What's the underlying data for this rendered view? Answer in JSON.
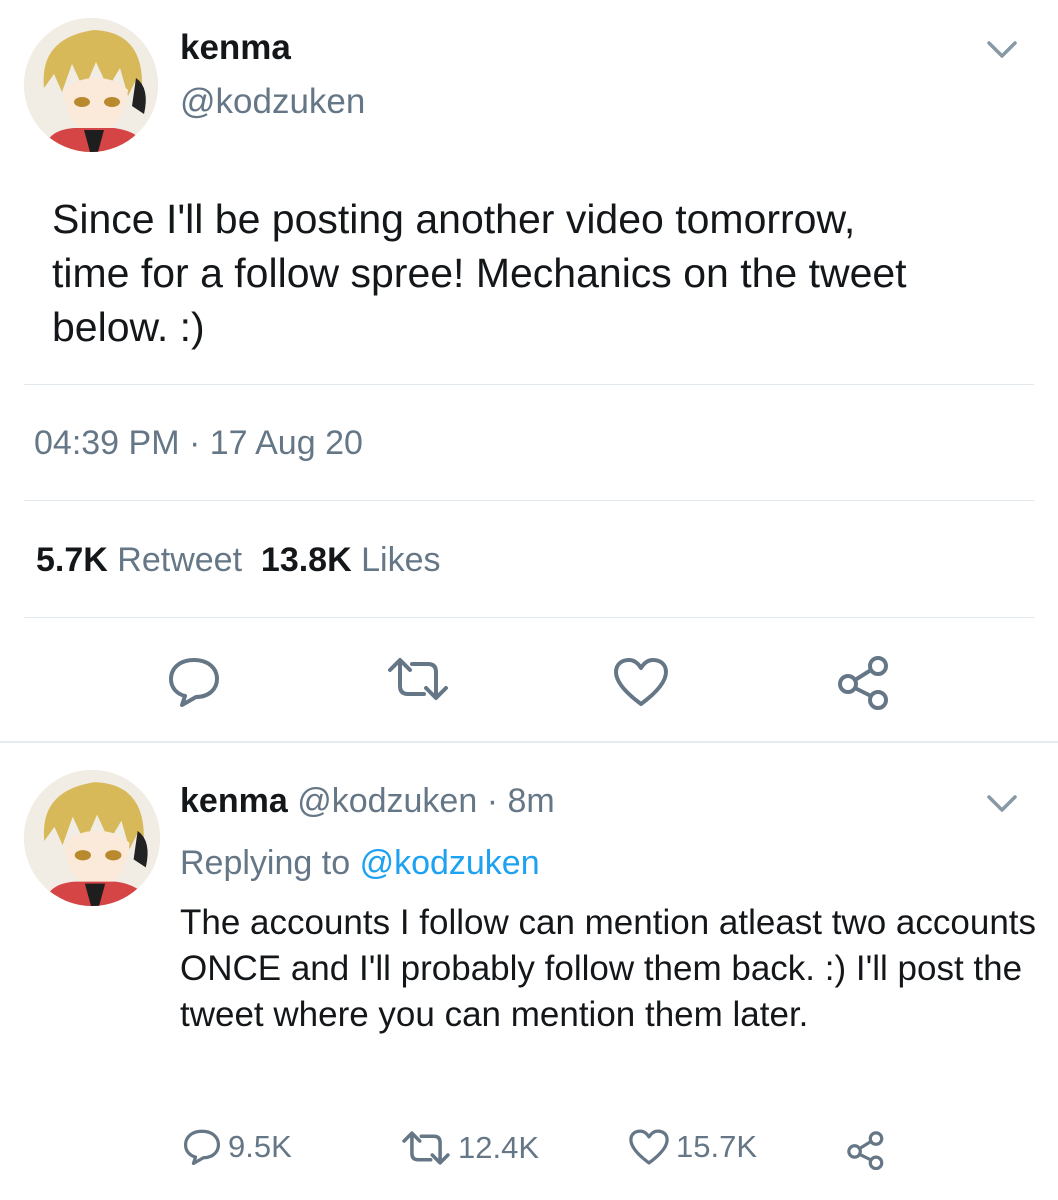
{
  "main_tweet": {
    "author_name": "kenma",
    "author_handle": "@kodzuken",
    "text": "Since I'll be posting another video tomorrow,\ntime for a follow spree! Mechanics on the tweet\nbelow. :)",
    "timestamp": "04:39 PM · 17 Aug 20",
    "retweet_count": "5.7K",
    "retweet_label": "Retweet",
    "like_count": "13.8K",
    "like_label": "Likes",
    "icons": [
      "reply-icon",
      "retweet-icon",
      "like-icon",
      "share-icon"
    ]
  },
  "reply_tweet": {
    "author_name": "kenma",
    "author_handle": "@kodzuken",
    "time_ago": "· 8m",
    "replying_prefix": "Replying to",
    "replying_handle": "@kodzuken",
    "text": "The accounts I follow can mention atleast two accounts ONCE and I'll probably follow them back. :) I'll post the tweet where you can mention them later.",
    "reply_count": "9.5K",
    "retweet_count": "12.4K",
    "like_count": "15.7K"
  },
  "colors": {
    "text": "#14171a",
    "secondary": "#657786",
    "link": "#1da1f2",
    "divider": "#e1e8ed"
  }
}
